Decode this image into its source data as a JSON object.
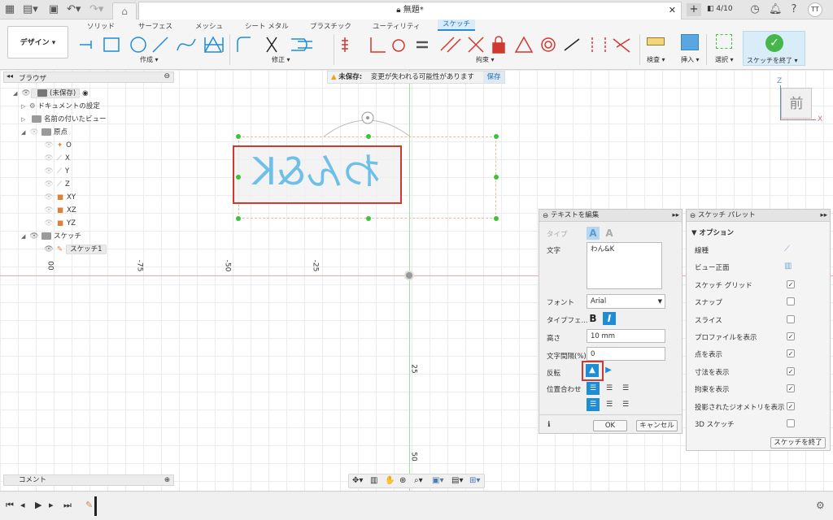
{
  "titlebar": {
    "doc_title": "無題*",
    "job_count": "4/10",
    "user_initials": "TT"
  },
  "toolbar": {
    "workspace": "デザイン",
    "tabs": [
      "ソリッド",
      "サーフェス",
      "メッシュ",
      "シート メタル",
      "プラスチック",
      "ユーティリティ"
    ],
    "active_tab": "スケッチ",
    "groups": {
      "create": "作成",
      "modify": "修正",
      "constraint": "拘束",
      "inspect": "検査",
      "insert": "挿入",
      "select": "選択",
      "finish": "スケッチを終了"
    }
  },
  "browser": {
    "title": "ブラウザ",
    "root": "(未保存)",
    "items": {
      "doc_settings": "ドキュメントの設定",
      "named_views": "名前の付いたビュー",
      "origin": "原点",
      "o": "O",
      "x": "X",
      "y": "Y",
      "z": "Z",
      "xy": "XY",
      "xz": "XZ",
      "yz": "YZ",
      "sketches": "スケッチ",
      "sketch1": "スケッチ1"
    }
  },
  "warning": {
    "label": "未保存:",
    "message": "変更が失われる可能性があります",
    "save": "保存"
  },
  "canvas": {
    "sketch_text": "わん&K",
    "ticks": {
      "x100": "00",
      "x75": "-75",
      "x50": "-50",
      "x25": "-25",
      "y25": "25",
      "y50": "50"
    },
    "viewcube_face": "前",
    "axis_z": "Z",
    "axis_x": "X"
  },
  "edit_text": {
    "title": "テキストを編集",
    "type_label": "タイプ",
    "text_label": "文字",
    "text_value": "わん&K",
    "font_label": "フォント",
    "font_value": "Arial",
    "typeface_label": "タイプフェ...",
    "bold": "B",
    "italic": "I",
    "height_label": "高さ",
    "height_value": "10 mm",
    "spacing_label": "文字間隔(%)",
    "spacing_value": "0",
    "flip_label": "反転",
    "align_label": "位置合わせ",
    "ok": "OK",
    "cancel": "キャンセル"
  },
  "palette": {
    "title": "スケッチ パレット",
    "section": "オプション",
    "rows": [
      {
        "label": "線種",
        "checked": null
      },
      {
        "label": "ビュー正面",
        "checked": null
      },
      {
        "label": "スケッチ グリッド",
        "checked": true
      },
      {
        "label": "スナップ",
        "checked": false
      },
      {
        "label": "スライス",
        "checked": false
      },
      {
        "label": "プロファイルを表示",
        "checked": true
      },
      {
        "label": "点を表示",
        "checked": true
      },
      {
        "label": "寸法を表示",
        "checked": true
      },
      {
        "label": "拘束を表示",
        "checked": true
      },
      {
        "label": "投影されたジオメトリを表示",
        "checked": true
      },
      {
        "label": "3D スケッチ",
        "checked": false
      }
    ],
    "finish": "スケッチを終了"
  },
  "comments": {
    "label": "コメント"
  },
  "colors": {
    "accent": "#1f8dd6",
    "highlight_red": "#d0392f",
    "sketch_blue": "#6fc0e8",
    "point_green": "#3bc33b"
  }
}
